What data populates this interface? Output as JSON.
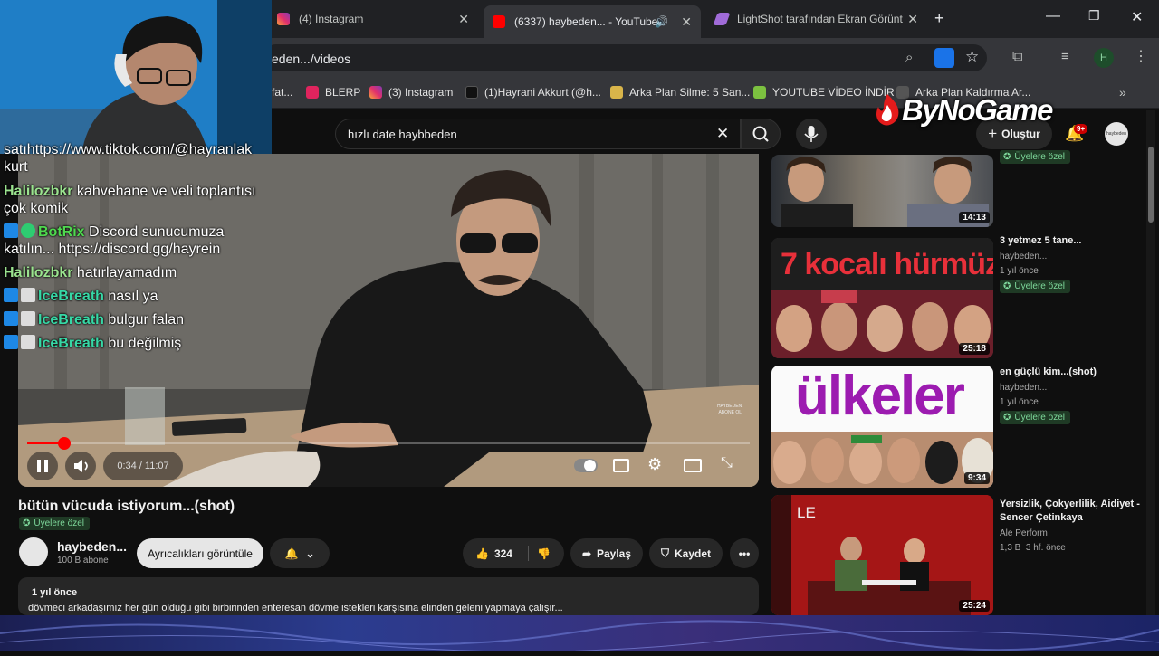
{
  "browser": {
    "tabs": [
      {
        "title": "(4) Instagram",
        "active": false
      },
      {
        "title": "(6337) haybeden... - YouTube",
        "active": true
      },
      {
        "title": "LightShot tarafından Ekran Görünt",
        "active": false
      }
    ],
    "new_tab": "+",
    "url": "eden.../videos",
    "profile_initial": "H",
    "bookmarks": [
      {
        "label": "fat..."
      },
      {
        "label": "BLERP"
      },
      {
        "label": "(3) Instagram"
      },
      {
        "label": "(1)Hayrani Akkurt (@h..."
      },
      {
        "label": "Arka Plan Silme: 5 San..."
      },
      {
        "label": "YOUTUBE VİDEO İNDİR"
      },
      {
        "label": "Arka Plan Kaldırma Ar..."
      }
    ]
  },
  "watermark": "ByNoGame",
  "youtube": {
    "search_value": "hızlı date haybbeden",
    "create_label": "Oluştur",
    "notif_badge": "9+",
    "avatar_text": "haybeden",
    "player": {
      "time": "0:34 / 11:07",
      "progress": 0.051,
      "overlay_text": "HAYBEDEN.\nABONE OL"
    },
    "video": {
      "title": "bütün vücuda istiyorum...(shot)",
      "members_only": "Üyelere özel",
      "channel": "haybeden...",
      "subscribers": "100 B abone",
      "perks_button": "Ayrıcalıkları görüntüle",
      "likes": "324",
      "share": "Paylaş",
      "save": "Kaydet",
      "desc_meta": "1 yıl önce",
      "desc_text": "dövmeci arkadaşımız her gün olduğu gibi birbirinden enteresan dövme istekleri karşısına elinden geleni yapmaya çalışır..."
    },
    "sidebar": [
      {
        "title": "",
        "channel": "",
        "meta": "",
        "badge": "Üyelere özel",
        "duration": "14:13",
        "thumb_text": ""
      },
      {
        "title": "3 yetmez 5 tane...",
        "channel": "haybeden...",
        "meta": "1 yıl önce",
        "badge": "Üyelere özel",
        "duration": "25:18",
        "thumb_text": "7 kocalı hürmüz"
      },
      {
        "title": "en güçlü kim...(shot)",
        "channel": "haybeden...",
        "meta": "1 yıl önce",
        "badge": "Üyelere özel",
        "duration": "9:34",
        "thumb_text": "ülkeler"
      },
      {
        "title": "Yersizlik, Çokyerlilik, Aidiyet - Sencer Çetinkaya",
        "channel": "Ale Perform",
        "meta": "1,3 B  3 hf. önce",
        "badge": "",
        "duration": "25:24",
        "thumb_text": "LE"
      }
    ]
  },
  "chat": [
    {
      "user": "",
      "msg": "satıhttps://www.tiktok.com/@hayranlak kurt",
      "color": "#ffffff"
    },
    {
      "user": "Halilozbkr",
      "msg": "kahvehane ve veli toplantısı çok komik",
      "color": "#9be38f"
    },
    {
      "user": "BotRix",
      "msg": "Discord sunucumuza katılın... https://discord.gg/hayrein",
      "color": "#4fd84f"
    },
    {
      "user": "Halilozbkr",
      "msg": "hatırlayamadım",
      "color": "#9be38f"
    },
    {
      "user": "IceBreath",
      "msg": "nasıl ya",
      "color": "#37d8a6"
    },
    {
      "user": "IceBreath",
      "msg": "bulgur falan",
      "color": "#37d8a6"
    },
    {
      "user": "IceBreath",
      "msg": "bu değilmiş",
      "color": "#37d8a6"
    }
  ],
  "colors": {
    "accent_red": "#ff0000",
    "member_green": "#7ed89b"
  }
}
